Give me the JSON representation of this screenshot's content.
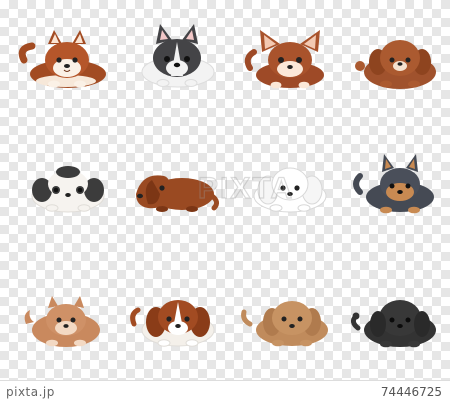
{
  "watermark": "PIXTA",
  "footer": {
    "site": "pixta.jp",
    "image_id": "74446725"
  },
  "dogs": [
    {
      "name": "shiba-dog-icon",
      "body": "#a24b22",
      "head": "#b5562a",
      "ears": "#a24b22",
      "inner_ear": "#7a3512",
      "face": "#fbf1e6",
      "eye": "#222222"
    },
    {
      "name": "french-bulldog-icon",
      "body": "#f3f3f3",
      "head": "#444447",
      "ears": "#444447",
      "inner_ear": "#f2c7c7",
      "face": "#f3f3f3",
      "eye": "#111111"
    },
    {
      "name": "chihuahua-dog-icon",
      "body": "#9e4a27",
      "head": "#a9532c",
      "ears": "#a9532c",
      "inner_ear": "#f3c9b2",
      "face": "#fbe8d8",
      "eye": "#222222"
    },
    {
      "name": "poodle-dog-icon",
      "body": "#a0522d",
      "head": "#ab5a30",
      "ears": "#8e441f",
      "inner_ear": "#8e441f",
      "face": "#ab5a30",
      "eye": "#222222"
    },
    {
      "name": "shih-tzu-dog-icon",
      "body": "#f6f3ef",
      "head": "#f6f3ef",
      "ears": "#3c3c3c",
      "inner_ear": "#3c3c3c",
      "face": "#ffffff",
      "eye": "#222222"
    },
    {
      "name": "dachshund-dog-icon",
      "body": "#9a4a22",
      "head": "#9a4a22",
      "ears": "#7c3615",
      "inner_ear": "#7c3615",
      "face": "#9a4a22",
      "eye": "#222222"
    },
    {
      "name": "maltese-dog-icon",
      "body": "#ffffff",
      "head": "#ffffff",
      "ears": "#f1f1f1",
      "inner_ear": "#f1f1f1",
      "face": "#ffffff",
      "eye": "#222222"
    },
    {
      "name": "yorkshire-terrier-dog-icon",
      "body": "#454a54",
      "head": "#4a4f5a",
      "ears": "#454a54",
      "inner_ear": "#c88a52",
      "face": "#c88a52",
      "eye": "#111111"
    },
    {
      "name": "pomeranian-dog-icon",
      "body": "#c9895e",
      "head": "#cf9167",
      "ears": "#c9895e",
      "inner_ear": "#b4744b",
      "face": "#f3d9c3",
      "eye": "#222222"
    },
    {
      "name": "beagle-dog-icon",
      "body": "#f4f0ea",
      "head": "#a24b22",
      "ears": "#8a3c18",
      "inner_ear": "#8a3c18",
      "face": "#ffffff",
      "eye": "#222222"
    },
    {
      "name": "mini-dachshund-dog-icon",
      "body": "#c08b5c",
      "head": "#c79363",
      "ears": "#b07b4e",
      "inner_ear": "#b07b4e",
      "face": "#c79363",
      "eye": "#222222"
    },
    {
      "name": "black-poodle-dog-icon",
      "body": "#333333",
      "head": "#383838",
      "ears": "#2a2a2a",
      "inner_ear": "#2a2a2a",
      "face": "#383838",
      "eye": "#0b0b0b"
    }
  ]
}
